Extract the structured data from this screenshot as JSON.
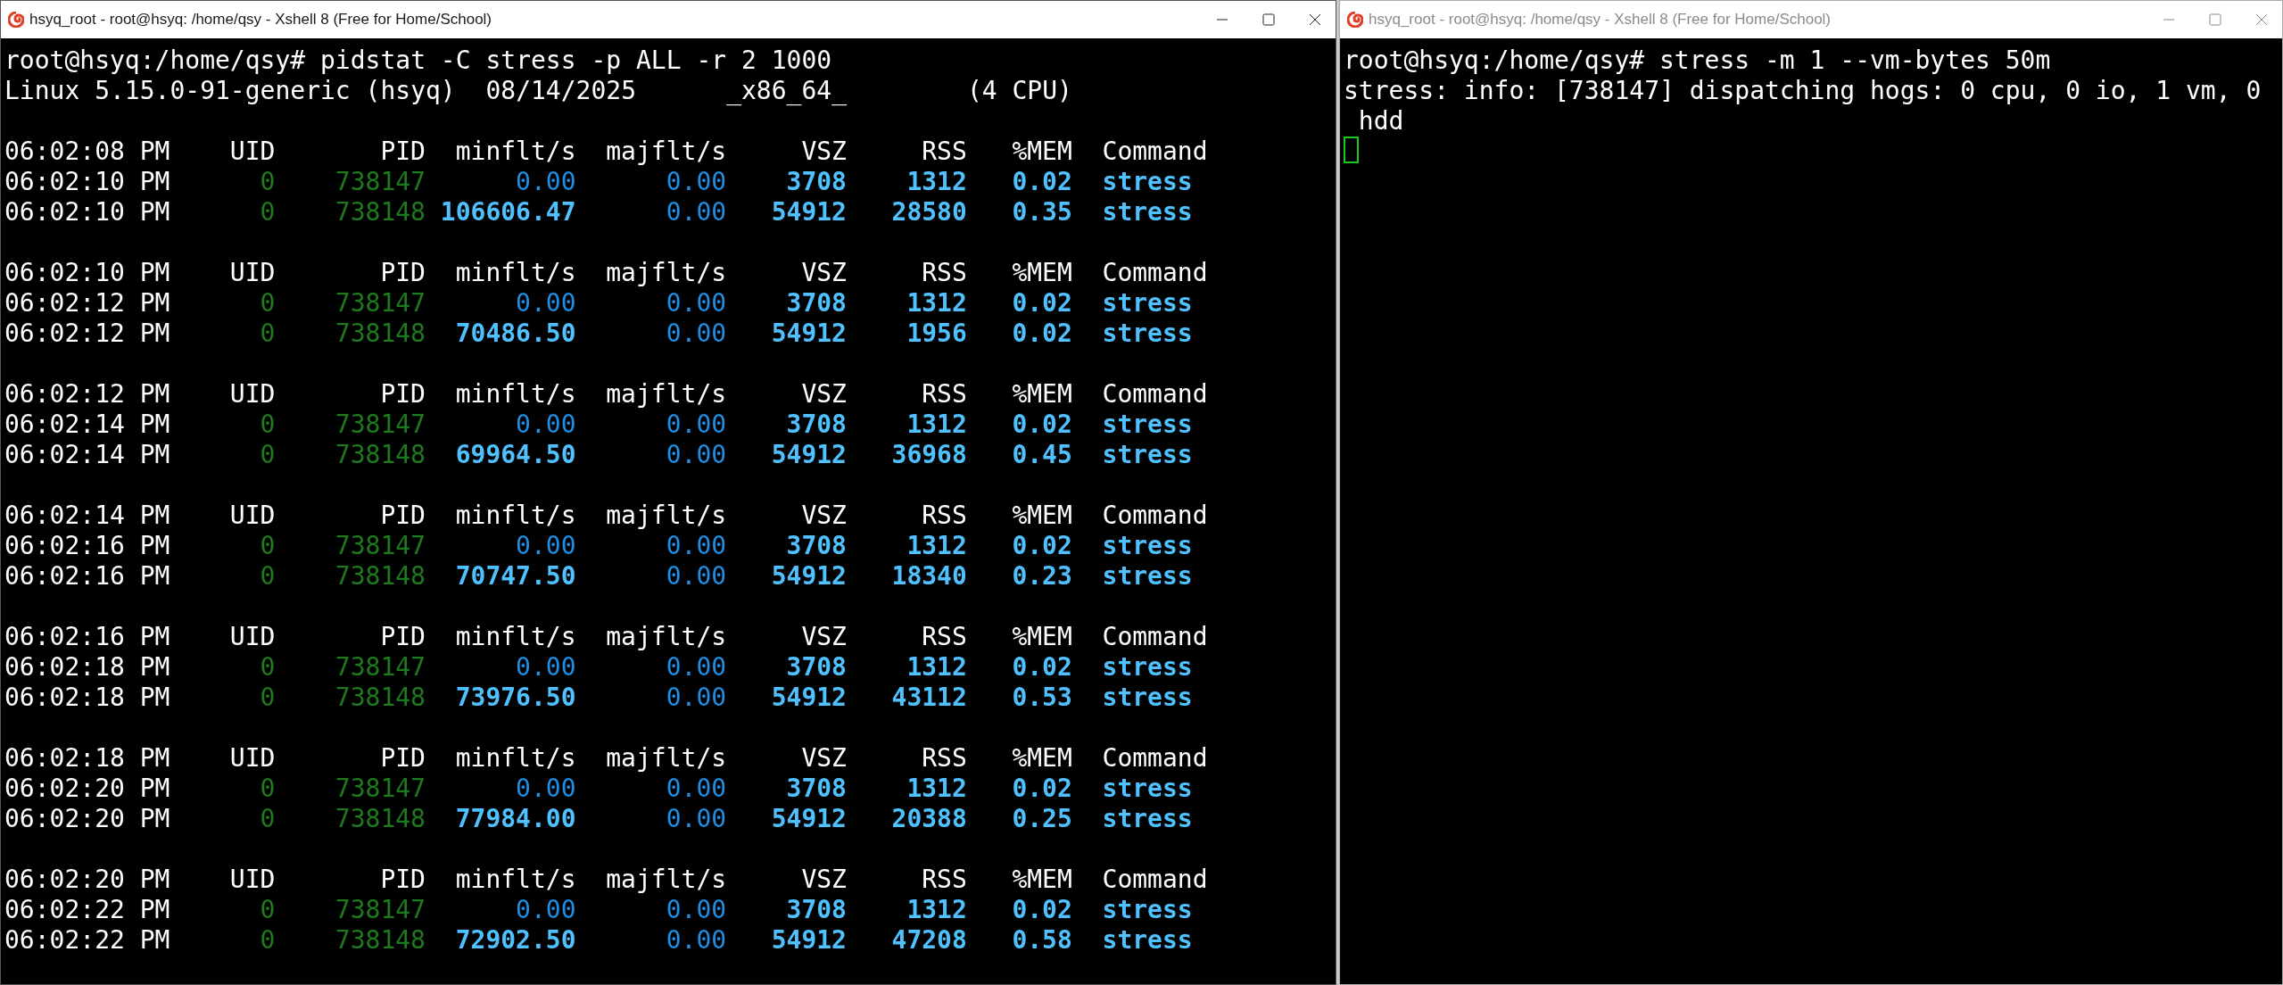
{
  "windows": [
    {
      "title": "hsyq_root - root@hsyq: /home/qsy - Xshell 8 (Free for Home/School)",
      "active": true,
      "terminal": {
        "lines": [
          "root@hsyq:/home/qsy# pidstat -C stress -p ALL -r 2 1000",
          "Linux 5.15.0-91-generic (hsyq)  08/14/2025      _x86_64_        (4 CPU)"
        ],
        "blocks": [
          {
            "time": "06:02:08 PM",
            "columns": [
              "UID",
              "PID",
              "minflt/s",
              "majflt/s",
              "VSZ",
              "RSS",
              "%MEM",
              "Command"
            ],
            "rows": [
              {
                "time": "06:02:10 PM",
                "uid": "0",
                "pid": "738147",
                "minflt": "0.00",
                "minflt_bold": false,
                "majflt": "0.00",
                "vsz": "3708",
                "rss": "1312",
                "mem": "0.02",
                "command": "stress"
              },
              {
                "time": "06:02:10 PM",
                "uid": "0",
                "pid": "738148",
                "minflt": "106606.47",
                "minflt_bold": true,
                "majflt": "0.00",
                "vsz": "54912",
                "rss": "28580",
                "mem": "0.35",
                "command": "stress"
              }
            ]
          },
          {
            "time": "06:02:10 PM",
            "columns": [
              "UID",
              "PID",
              "minflt/s",
              "majflt/s",
              "VSZ",
              "RSS",
              "%MEM",
              "Command"
            ],
            "rows": [
              {
                "time": "06:02:12 PM",
                "uid": "0",
                "pid": "738147",
                "minflt": "0.00",
                "minflt_bold": false,
                "majflt": "0.00",
                "vsz": "3708",
                "rss": "1312",
                "mem": "0.02",
                "command": "stress"
              },
              {
                "time": "06:02:12 PM",
                "uid": "0",
                "pid": "738148",
                "minflt": "70486.50",
                "minflt_bold": true,
                "majflt": "0.00",
                "vsz": "54912",
                "rss": "1956",
                "mem": "0.02",
                "command": "stress"
              }
            ]
          },
          {
            "time": "06:02:12 PM",
            "columns": [
              "UID",
              "PID",
              "minflt/s",
              "majflt/s",
              "VSZ",
              "RSS",
              "%MEM",
              "Command"
            ],
            "rows": [
              {
                "time": "06:02:14 PM",
                "uid": "0",
                "pid": "738147",
                "minflt": "0.00",
                "minflt_bold": false,
                "majflt": "0.00",
                "vsz": "3708",
                "rss": "1312",
                "mem": "0.02",
                "command": "stress"
              },
              {
                "time": "06:02:14 PM",
                "uid": "0",
                "pid": "738148",
                "minflt": "69964.50",
                "minflt_bold": true,
                "majflt": "0.00",
                "vsz": "54912",
                "rss": "36968",
                "mem": "0.45",
                "command": "stress"
              }
            ]
          },
          {
            "time": "06:02:14 PM",
            "columns": [
              "UID",
              "PID",
              "minflt/s",
              "majflt/s",
              "VSZ",
              "RSS",
              "%MEM",
              "Command"
            ],
            "rows": [
              {
                "time": "06:02:16 PM",
                "uid": "0",
                "pid": "738147",
                "minflt": "0.00",
                "minflt_bold": false,
                "majflt": "0.00",
                "vsz": "3708",
                "rss": "1312",
                "mem": "0.02",
                "command": "stress"
              },
              {
                "time": "06:02:16 PM",
                "uid": "0",
                "pid": "738148",
                "minflt": "70747.50",
                "minflt_bold": true,
                "majflt": "0.00",
                "vsz": "54912",
                "rss": "18340",
                "mem": "0.23",
                "command": "stress"
              }
            ]
          },
          {
            "time": "06:02:16 PM",
            "columns": [
              "UID",
              "PID",
              "minflt/s",
              "majflt/s",
              "VSZ",
              "RSS",
              "%MEM",
              "Command"
            ],
            "rows": [
              {
                "time": "06:02:18 PM",
                "uid": "0",
                "pid": "738147",
                "minflt": "0.00",
                "minflt_bold": false,
                "majflt": "0.00",
                "vsz": "3708",
                "rss": "1312",
                "mem": "0.02",
                "command": "stress"
              },
              {
                "time": "06:02:18 PM",
                "uid": "0",
                "pid": "738148",
                "minflt": "73976.50",
                "minflt_bold": true,
                "majflt": "0.00",
                "vsz": "54912",
                "rss": "43112",
                "mem": "0.53",
                "command": "stress"
              }
            ]
          },
          {
            "time": "06:02:18 PM",
            "columns": [
              "UID",
              "PID",
              "minflt/s",
              "majflt/s",
              "VSZ",
              "RSS",
              "%MEM",
              "Command"
            ],
            "rows": [
              {
                "time": "06:02:20 PM",
                "uid": "0",
                "pid": "738147",
                "minflt": "0.00",
                "minflt_bold": false,
                "majflt": "0.00",
                "vsz": "3708",
                "rss": "1312",
                "mem": "0.02",
                "command": "stress"
              },
              {
                "time": "06:02:20 PM",
                "uid": "0",
                "pid": "738148",
                "minflt": "77984.00",
                "minflt_bold": true,
                "majflt": "0.00",
                "vsz": "54912",
                "rss": "20388",
                "mem": "0.25",
                "command": "stress"
              }
            ]
          },
          {
            "time": "06:02:20 PM",
            "columns": [
              "UID",
              "PID",
              "minflt/s",
              "majflt/s",
              "VSZ",
              "RSS",
              "%MEM",
              "Command"
            ],
            "rows": [
              {
                "time": "06:02:22 PM",
                "uid": "0",
                "pid": "738147",
                "minflt": "0.00",
                "minflt_bold": false,
                "majflt": "0.00",
                "vsz": "3708",
                "rss": "1312",
                "mem": "0.02",
                "command": "stress"
              },
              {
                "time": "06:02:22 PM",
                "uid": "0",
                "pid": "738148",
                "minflt": "72902.50",
                "minflt_bold": true,
                "majflt": "0.00",
                "vsz": "54912",
                "rss": "47208",
                "mem": "0.58",
                "command": "stress"
              }
            ]
          }
        ],
        "cursor": false
      }
    },
    {
      "title": "hsyq_root - root@hsyq: /home/qsy - Xshell 8 (Free for Home/School)",
      "active": false,
      "terminal": {
        "lines": [
          "root@hsyq:/home/qsy# stress -m 1 --vm-bytes 50m",
          "stress: info: [738147] dispatching hogs: 0 cpu, 0 io, 1 vm, 0",
          " hdd"
        ],
        "cursor": true
      }
    }
  ]
}
